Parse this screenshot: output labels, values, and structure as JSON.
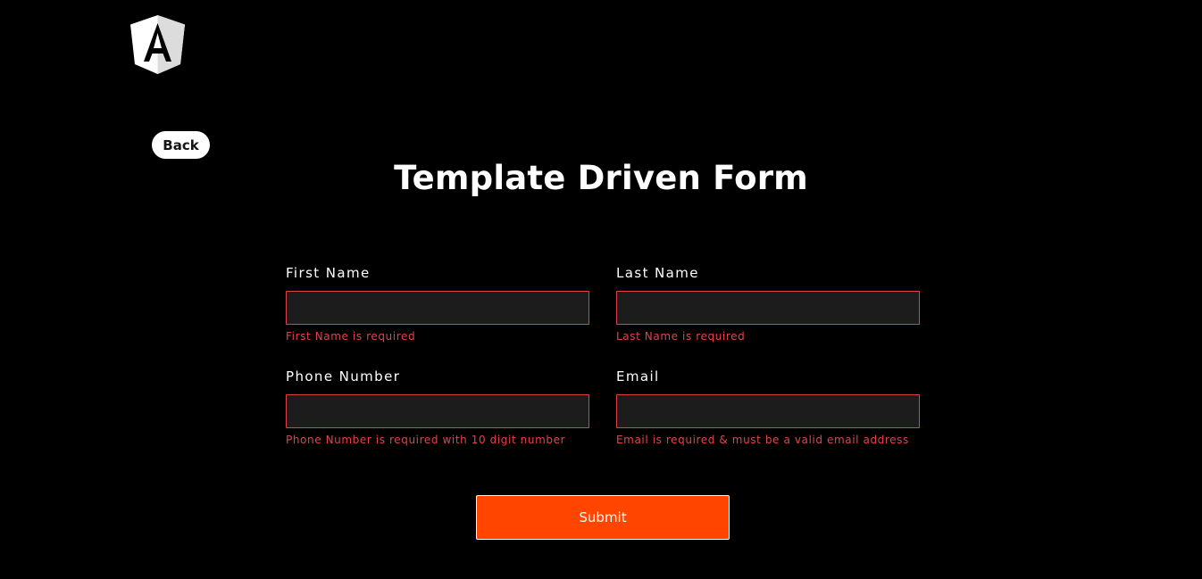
{
  "header": {
    "logo_icon": "angular-logo-icon"
  },
  "nav": {
    "back_label": "Back"
  },
  "page": {
    "title": "Template Driven Form"
  },
  "form": {
    "first_name": {
      "label": "First Name",
      "value": "",
      "error": "First Name is required"
    },
    "last_name": {
      "label": "Last Name",
      "value": "",
      "error": "Last Name is required"
    },
    "phone": {
      "label": "Phone Number",
      "value": "",
      "error": "Phone Number is required with 10 digit number"
    },
    "email": {
      "label": "Email",
      "value": "",
      "error": "Email is required & must be a valid email address"
    },
    "submit_label": "Submit"
  },
  "colors": {
    "background": "#000000",
    "input_background": "#1c1c1c",
    "error": "#e2434b",
    "accent": "#ff4500",
    "text": "#ffffff"
  }
}
